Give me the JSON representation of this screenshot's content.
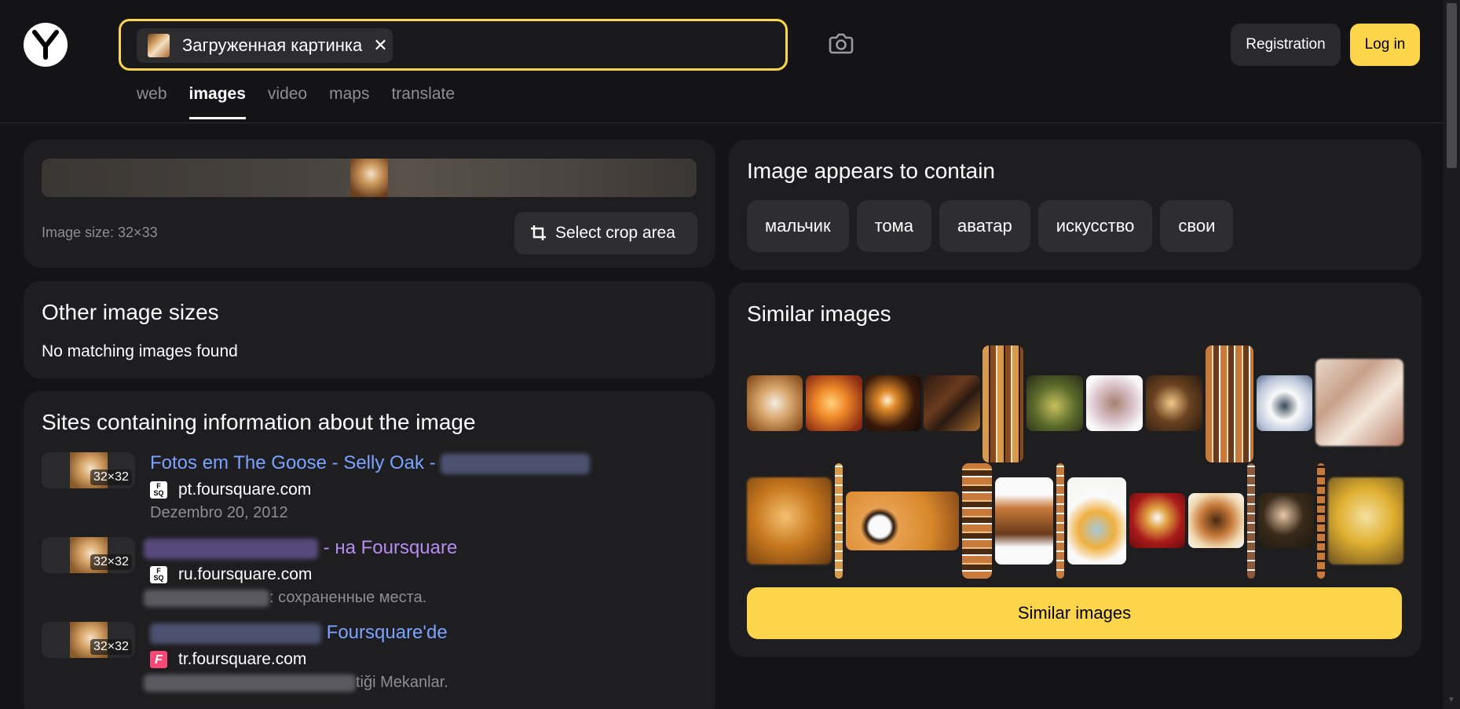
{
  "header": {
    "search_chip_label": "Загруженная картинка",
    "registration_label": "Registration",
    "login_label": "Log in"
  },
  "tabs": [
    {
      "label": "web"
    },
    {
      "label": "images"
    },
    {
      "label": "video"
    },
    {
      "label": "maps"
    },
    {
      "label": "translate"
    }
  ],
  "preview": {
    "image_size": "Image size: 32×33",
    "crop_label": "Select crop area"
  },
  "contains": {
    "title": "Image appears to contain",
    "tags": [
      "мальчик",
      "тома",
      "аватар",
      "искусство",
      "свои"
    ]
  },
  "other_sizes": {
    "title": "Other image sizes",
    "message": "No matching images found"
  },
  "sites": {
    "title": "Sites containing information about the image",
    "items": [
      {
        "thumb_badge": "32×32",
        "title": "Fotos em The Goose - Selly Oak -",
        "host": "pt.foursquare.com",
        "subtitle": "Dezembro 20, 2012"
      },
      {
        "thumb_badge": "32×32",
        "title": "- на Foursquare",
        "host": "ru.foursquare.com",
        "subtitle": ": сохраненные места."
      },
      {
        "thumb_badge": "32×32",
        "title": "Foursquare'de",
        "host": "tr.foursquare.com",
        "subtitle": "tiği Mekanlar."
      }
    ]
  },
  "similar": {
    "title": "Similar images",
    "button_label": "Similar images"
  },
  "colors": {
    "accent": "#fcd54a",
    "link": "#7aa2ff",
    "visited_link": "#b58cf0",
    "card_bg": "#1e1e21",
    "page_bg": "#141416"
  }
}
